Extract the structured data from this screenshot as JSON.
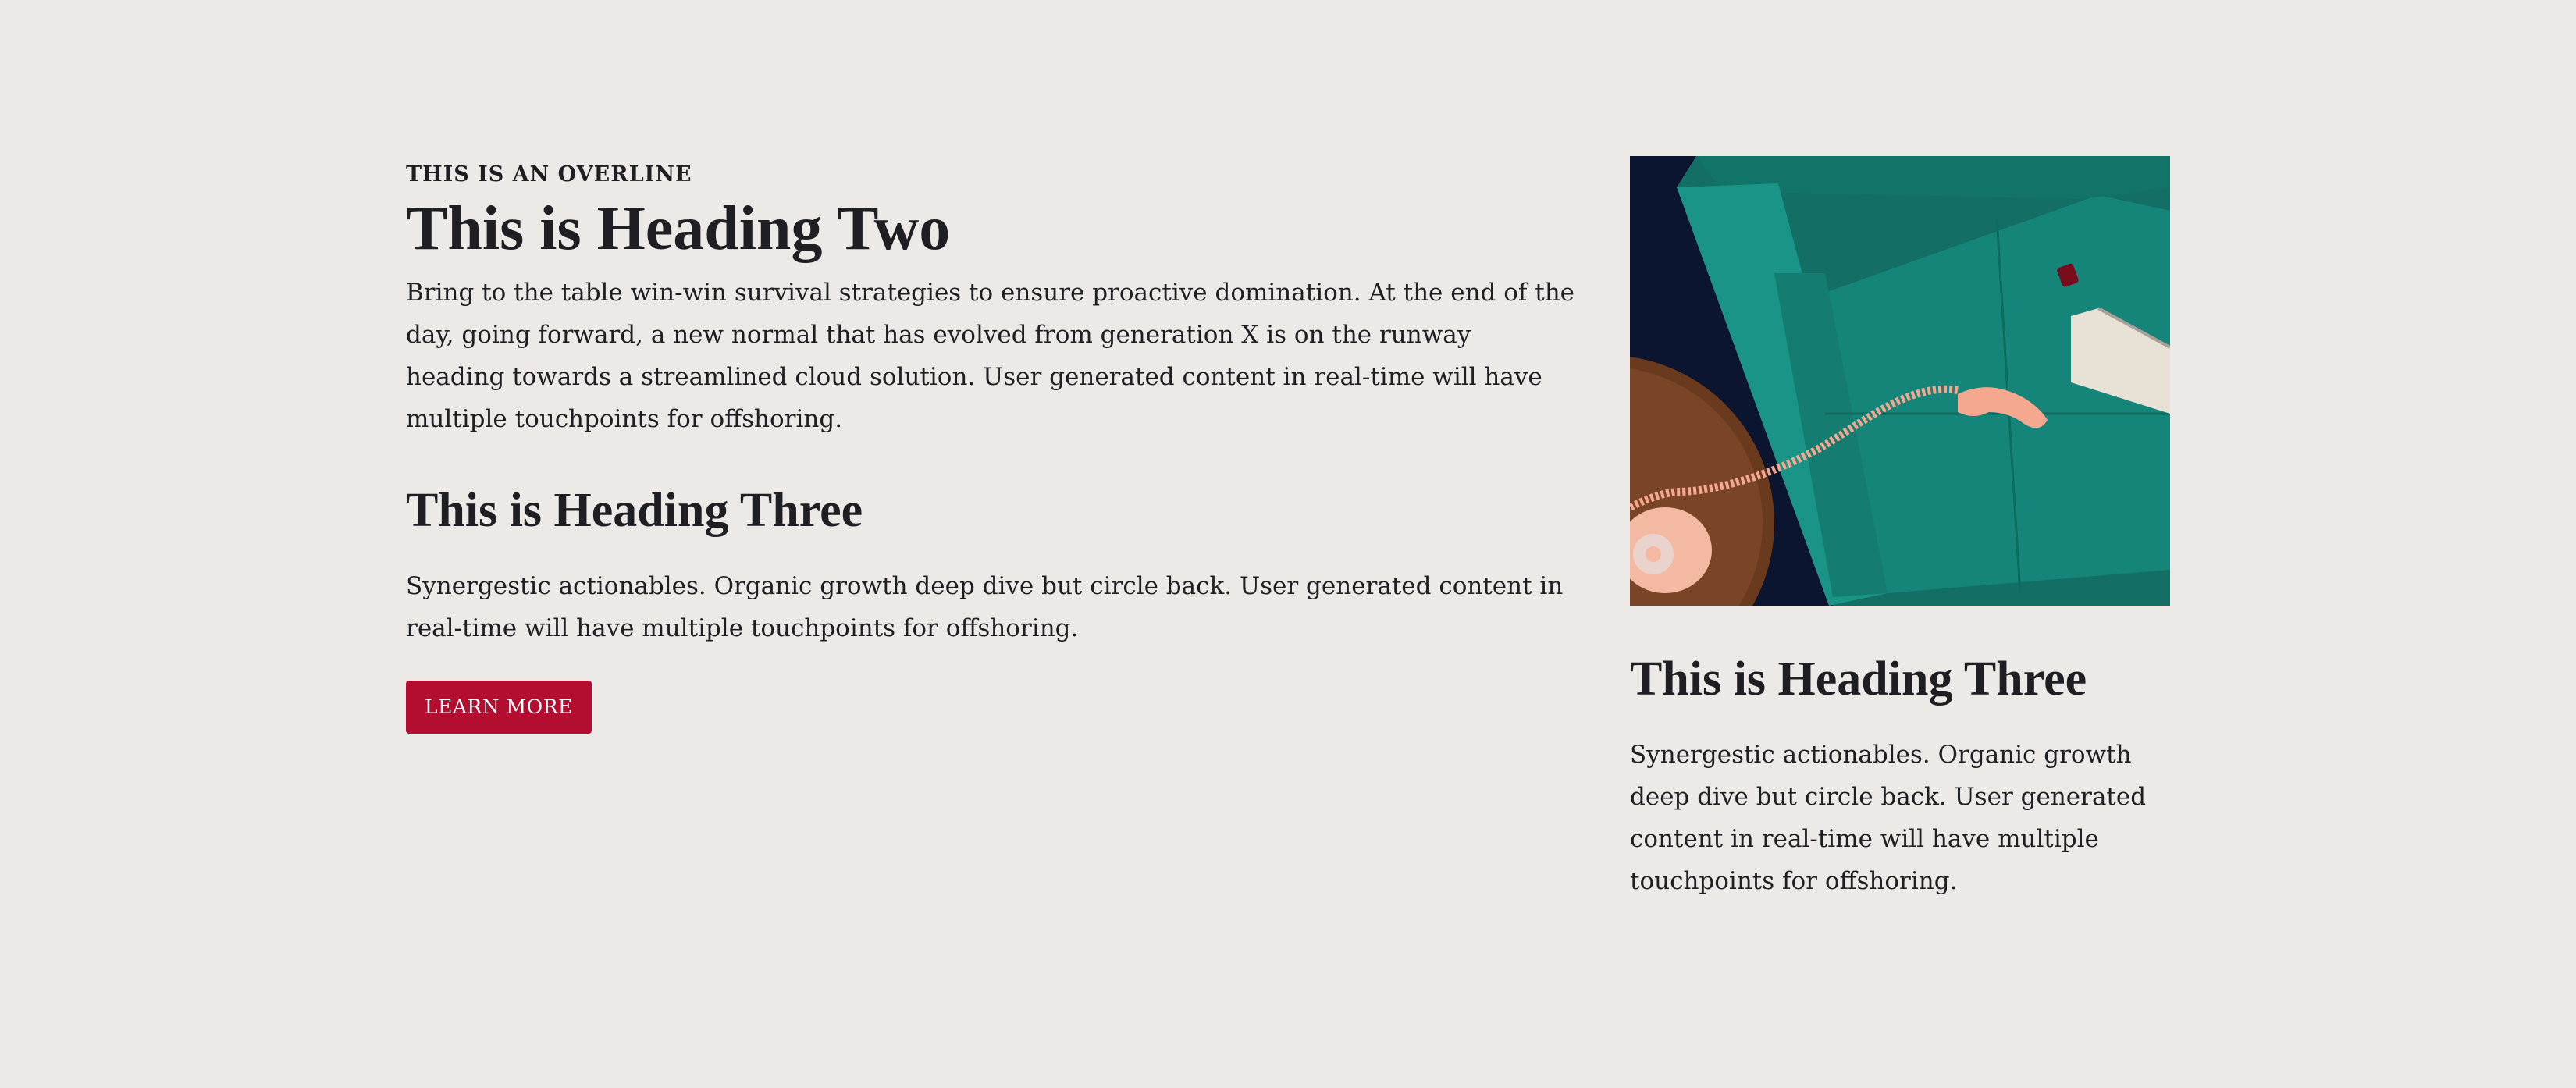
{
  "main": {
    "overline": "THIS IS AN OVERLINE",
    "heading_two": "This is Heading Two",
    "intro": "Bring to the table win-win survival strategies to ensure proactive domination. At the end of the day, going forward, a new normal that has evolved from generation X is on the runway heading towards a streamlined cloud solution. User generated content in real-time will have multiple touchpoints for offshoring.",
    "heading_three": "This is Heading Three",
    "paragraph": "Synergestic actionables. Organic growth deep dive but circle back. User generated content in real-time will have multiple touchpoints for offshoring.",
    "button_label": "LEARN MORE"
  },
  "card": {
    "image_icon": "photo-teal-sofa-with-pink-rotary-phone",
    "heading_three": "This is Heading Three",
    "paragraph": "Synergestic actionables. Organic growth deep dive but circle back. User generated content in real-time will have multiple touchpoints for offshoring."
  },
  "colors": {
    "background": "#ede9e6",
    "text": "#1f1f23",
    "button": "#b30d2f",
    "button_text": "#ffffff"
  }
}
